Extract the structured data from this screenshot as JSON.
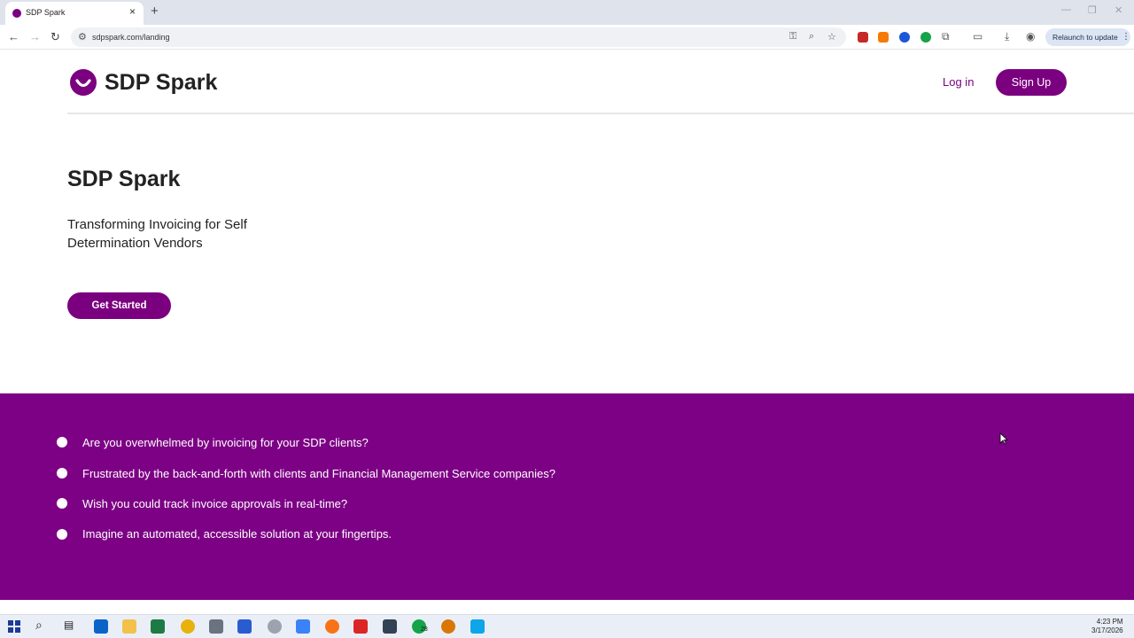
{
  "browser": {
    "tab_title": "SDP Spark",
    "tab_close": "×",
    "newtab": "+",
    "url": "sdpspark.com/landing",
    "relaunch_label": "Relaunch to update",
    "relaunch_menu": "⋮",
    "back": "←",
    "forward": "→",
    "reload": "↻",
    "win_min": "—",
    "win_restore": "❐",
    "win_close": "✕"
  },
  "site": {
    "brand": "SDP Spark",
    "login_label": "Log in",
    "signup_label": "Sign Up",
    "accent_color": "#7b0080"
  },
  "hero": {
    "title": "SDP Spark",
    "subtitle": "Transforming Invoicing for Self Determination Vendors",
    "cta_label": "Get Started"
  },
  "pain_points": [
    "Are you overwhelmed by invoicing for your SDP clients?",
    "Frustrated by the back-and-forth with clients and Financial Management Service companies?",
    "Wish you could track invoice approvals in real-time?",
    "Imagine an automated, accessible solution at your fingertips."
  ],
  "taskbar": {
    "time": "4:23 PM",
    "date": "3/17/2026",
    "whatsapp_badge": "28"
  }
}
